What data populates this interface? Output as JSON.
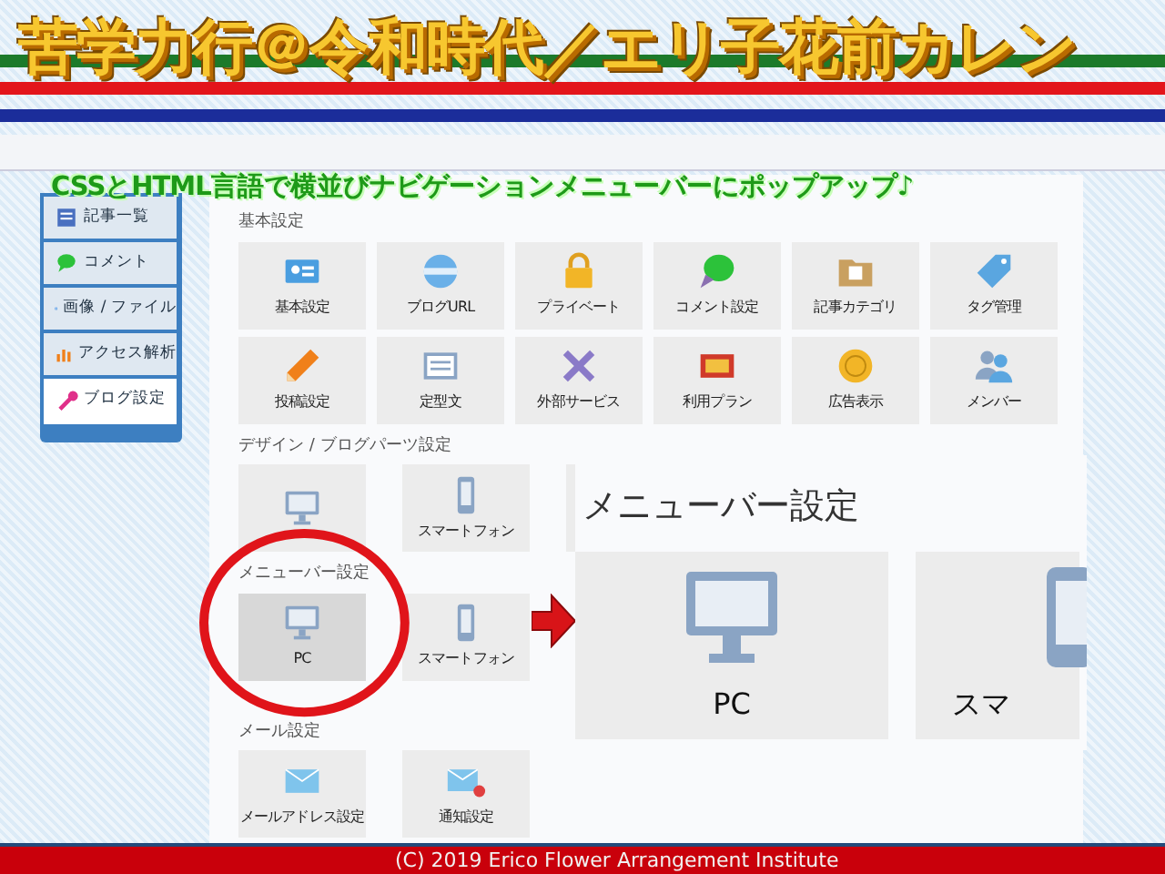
{
  "title": "苦学力行＠令和時代／エリ子花前カレン",
  "subtitle": "CSSとHTML言語で横並びナビゲーションメニューバーにポップアップ♪",
  "sidebar": {
    "items": [
      {
        "label": "記事一覧",
        "selected": false
      },
      {
        "label": "コメント",
        "selected": false
      },
      {
        "label": "画像 / ファイル",
        "selected": false
      },
      {
        "label": "アクセス解析",
        "selected": false
      },
      {
        "label": "ブログ設定",
        "selected": true
      }
    ]
  },
  "sections": [
    {
      "heading": "基本設定",
      "tiles": [
        {
          "label": "基本設定",
          "selected": false
        },
        {
          "label": "ブログURL",
          "selected": false
        },
        {
          "label": "プライベート",
          "selected": false
        },
        {
          "label": "コメント設定",
          "selected": false
        },
        {
          "label": "記事カテゴリ",
          "selected": false
        },
        {
          "label": "タグ管理",
          "selected": false
        },
        {
          "label": "投稿設定",
          "selected": false
        },
        {
          "label": "定型文",
          "selected": false
        },
        {
          "label": "外部サービス",
          "selected": false
        },
        {
          "label": "利用プラン",
          "selected": false
        },
        {
          "label": "広告表示",
          "selected": false
        },
        {
          "label": "メンバー",
          "selected": false
        }
      ]
    },
    {
      "heading": "デザイン / ブログパーツ設定",
      "tiles": [
        {
          "selected": false
        },
        {
          "label": "スマートフォン",
          "selected": false
        },
        {
          "selected": false
        }
      ]
    },
    {
      "heading": "メニューバー設定",
      "tiles": [
        {
          "label": "PC",
          "selected": true
        },
        {
          "label": "スマートフォン",
          "selected": false
        }
      ]
    },
    {
      "heading": "メール設定",
      "tiles": [
        {
          "label": "メールアドレス設定",
          "selected": false
        },
        {
          "label": "通知設定",
          "selected": false
        }
      ]
    }
  ],
  "popup": {
    "heading": "メニューバー設定",
    "tiles": [
      {
        "label": "PC"
      },
      {
        "label": "スマ"
      }
    ]
  },
  "footer": "(C) 2019 Erico Flower Arrangement Institute"
}
